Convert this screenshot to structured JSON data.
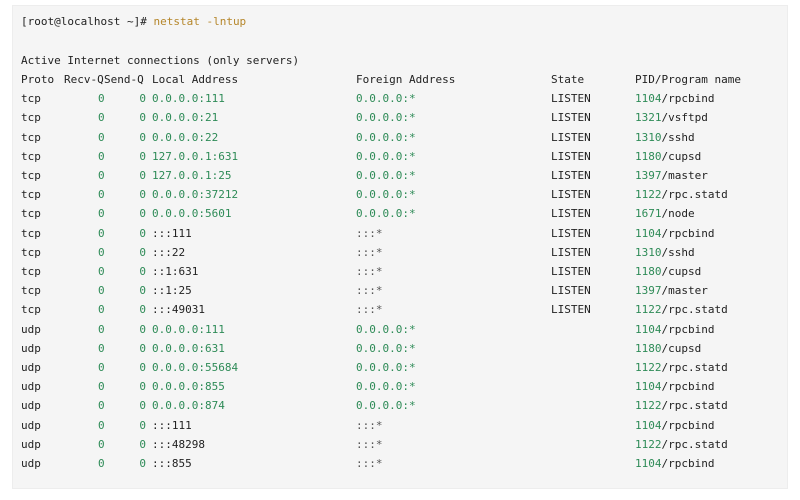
{
  "prompt": "[root@localhost ~]#",
  "command": "netstat -lntup",
  "section_title": "Active Internet connections (only servers)",
  "columns": [
    "Proto",
    "Recv-Q",
    "Send-Q",
    "Local Address",
    "Foreign Address",
    "State",
    "PID/Program name"
  ],
  "rows": [
    {
      "proto": "tcp",
      "recv": "0",
      "send": "0",
      "local": "0.0.0.0:111",
      "foreign": "0.0.0.0:*",
      "state": "LISTEN",
      "pid": "1104",
      "prog": "rpcbind"
    },
    {
      "proto": "tcp",
      "recv": "0",
      "send": "0",
      "local": "0.0.0.0:21",
      "foreign": "0.0.0.0:*",
      "state": "LISTEN",
      "pid": "1321",
      "prog": "vsftpd"
    },
    {
      "proto": "tcp",
      "recv": "0",
      "send": "0",
      "local": "0.0.0.0:22",
      "foreign": "0.0.0.0:*",
      "state": "LISTEN",
      "pid": "1310",
      "prog": "sshd"
    },
    {
      "proto": "tcp",
      "recv": "0",
      "send": "0",
      "local": "127.0.0.1:631",
      "foreign": "0.0.0.0:*",
      "state": "LISTEN",
      "pid": "1180",
      "prog": "cupsd"
    },
    {
      "proto": "tcp",
      "recv": "0",
      "send": "0",
      "local": "127.0.0.1:25",
      "foreign": "0.0.0.0:*",
      "state": "LISTEN",
      "pid": "1397",
      "prog": "master"
    },
    {
      "proto": "tcp",
      "recv": "0",
      "send": "0",
      "local": "0.0.0.0:37212",
      "foreign": "0.0.0.0:*",
      "state": "LISTEN",
      "pid": "1122",
      "prog": "rpc.statd"
    },
    {
      "proto": "tcp",
      "recv": "0",
      "send": "0",
      "local": "0.0.0.0:5601",
      "foreign": "0.0.0.0:*",
      "state": "LISTEN",
      "pid": "1671",
      "prog": "node"
    },
    {
      "proto": "tcp",
      "recv": "0",
      "send": "0",
      "local": ":::111",
      "foreign": ":::*",
      "state": "LISTEN",
      "pid": "1104",
      "prog": "rpcbind"
    },
    {
      "proto": "tcp",
      "recv": "0",
      "send": "0",
      "local": ":::22",
      "foreign": ":::*",
      "state": "LISTEN",
      "pid": "1310",
      "prog": "sshd"
    },
    {
      "proto": "tcp",
      "recv": "0",
      "send": "0",
      "local": "::1:631",
      "foreign": ":::*",
      "state": "LISTEN",
      "pid": "1180",
      "prog": "cupsd"
    },
    {
      "proto": "tcp",
      "recv": "0",
      "send": "0",
      "local": "::1:25",
      "foreign": ":::*",
      "state": "LISTEN",
      "pid": "1397",
      "prog": "master"
    },
    {
      "proto": "tcp",
      "recv": "0",
      "send": "0",
      "local": ":::49031",
      "foreign": ":::*",
      "state": "LISTEN",
      "pid": "1122",
      "prog": "rpc.statd"
    },
    {
      "proto": "udp",
      "recv": "0",
      "send": "0",
      "local": "0.0.0.0:111",
      "foreign": "0.0.0.0:*",
      "state": "",
      "pid": "1104",
      "prog": "rpcbind"
    },
    {
      "proto": "udp",
      "recv": "0",
      "send": "0",
      "local": "0.0.0.0:631",
      "foreign": "0.0.0.0:*",
      "state": "",
      "pid": "1180",
      "prog": "cupsd"
    },
    {
      "proto": "udp",
      "recv": "0",
      "send": "0",
      "local": "0.0.0.0:55684",
      "foreign": "0.0.0.0:*",
      "state": "",
      "pid": "1122",
      "prog": "rpc.statd"
    },
    {
      "proto": "udp",
      "recv": "0",
      "send": "0",
      "local": "0.0.0.0:855",
      "foreign": "0.0.0.0:*",
      "state": "",
      "pid": "1104",
      "prog": "rpcbind"
    },
    {
      "proto": "udp",
      "recv": "0",
      "send": "0",
      "local": "0.0.0.0:874",
      "foreign": "0.0.0.0:*",
      "state": "",
      "pid": "1122",
      "prog": "rpc.statd"
    },
    {
      "proto": "udp",
      "recv": "0",
      "send": "0",
      "local": ":::111",
      "foreign": ":::*",
      "state": "",
      "pid": "1104",
      "prog": "rpcbind"
    },
    {
      "proto": "udp",
      "recv": "0",
      "send": "0",
      "local": ":::48298",
      "foreign": ":::*",
      "state": "",
      "pid": "1122",
      "prog": "rpc.statd"
    },
    {
      "proto": "udp",
      "recv": "0",
      "send": "0",
      "local": ":::855",
      "foreign": ":::*",
      "state": "",
      "pid": "1104",
      "prog": "rpcbind"
    }
  ]
}
